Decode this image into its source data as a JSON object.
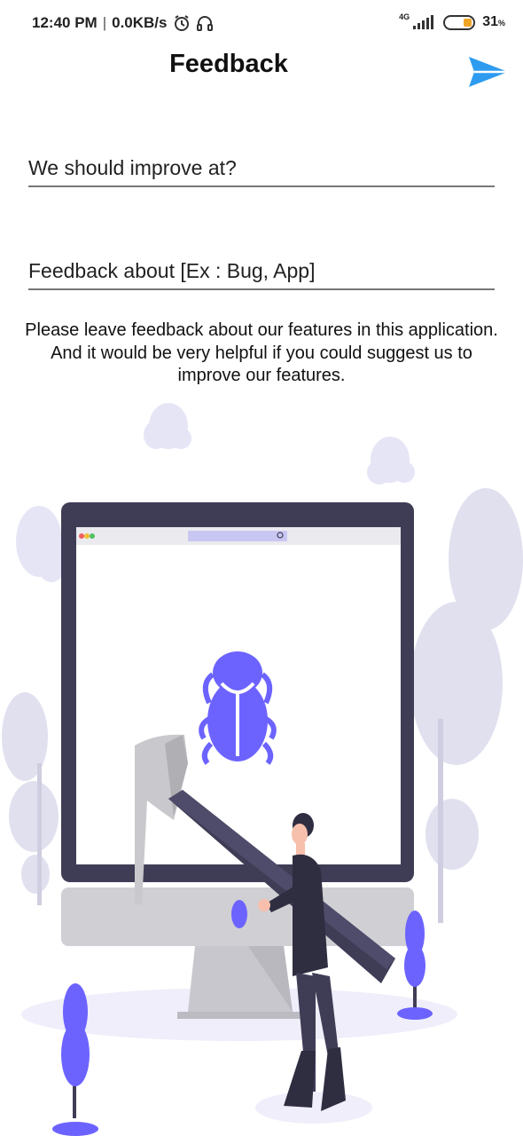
{
  "status_bar": {
    "time": "12:40 PM",
    "separator": "|",
    "net_speed": "0.0KB/s",
    "network_type": "4G",
    "battery_percent": "31",
    "battery_unit": "%",
    "alarm_icon": "alarm-icon",
    "headphones_icon": "headphones-icon",
    "signal_icon": "signal-icon"
  },
  "header": {
    "title": "Feedback",
    "send_icon": "send-icon",
    "accent_color": "#2d9cf0"
  },
  "form": {
    "improve_placeholder": "We should improve at?",
    "about_placeholder": "Feedback about [Ex : Bug, App]"
  },
  "description": {
    "line1": "Please leave feedback about our features in this application.",
    "line2": "And it would be very helpful if you could suggest us to",
    "line3": "improve our features."
  },
  "illustration": {
    "icon": "bug-repair-illustration",
    "primary_color": "#6c63ff",
    "dark_color": "#3f3d56"
  }
}
